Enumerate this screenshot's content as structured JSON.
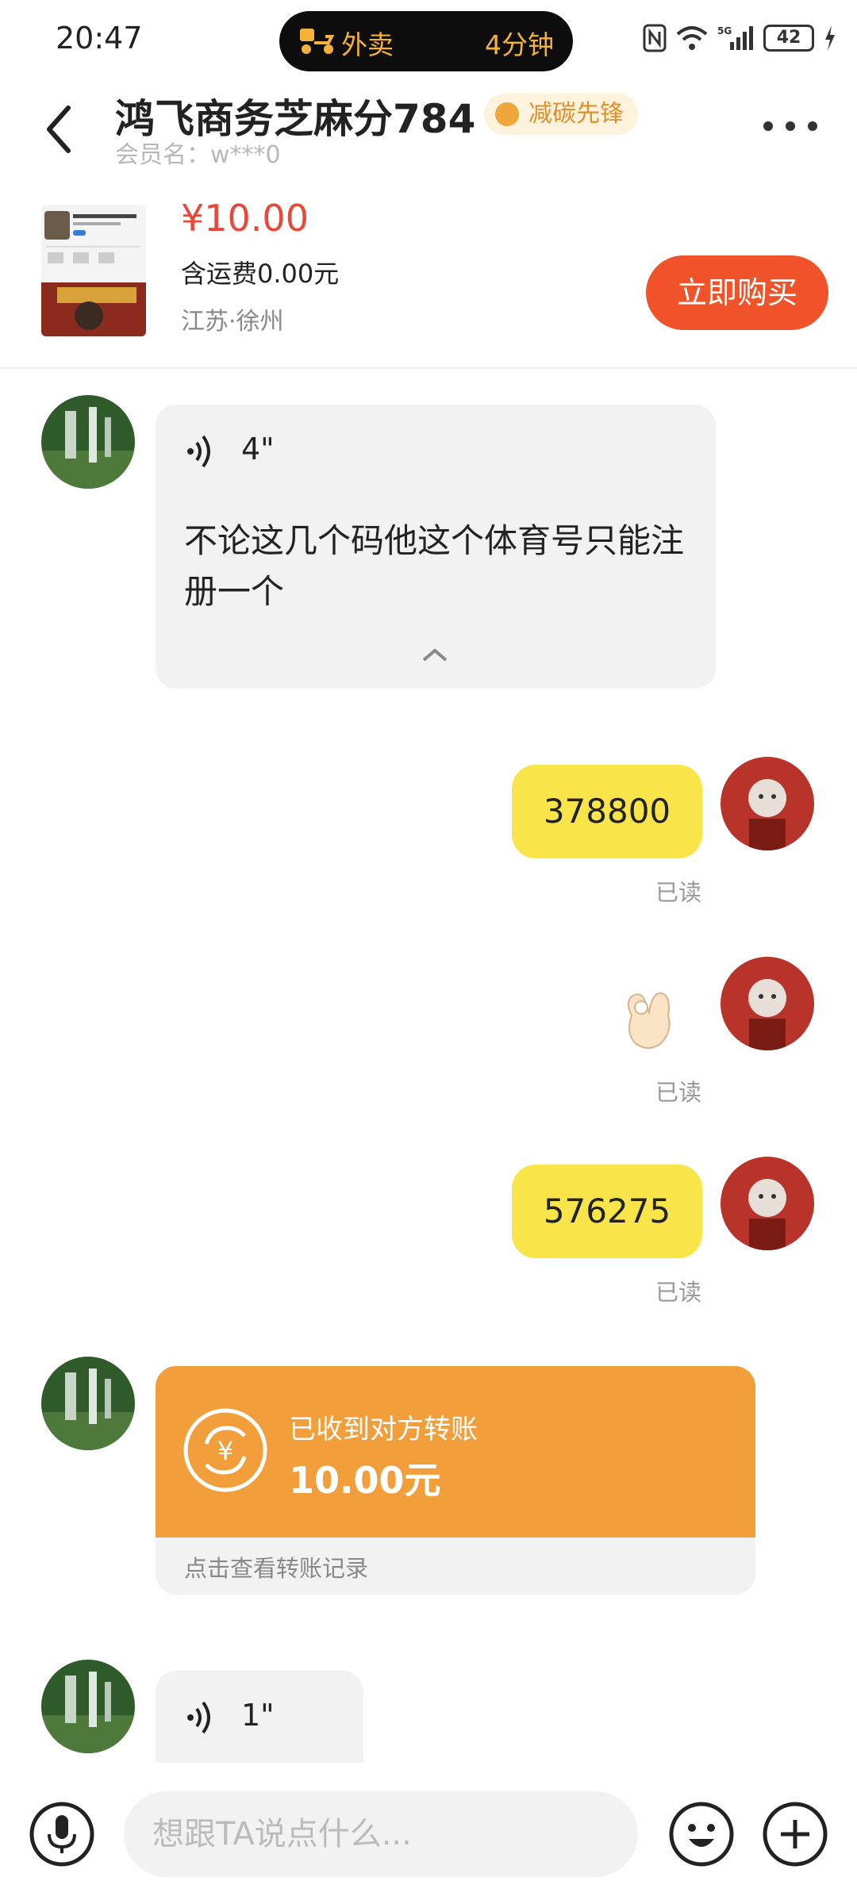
{
  "status_bar": {
    "time": "20:47",
    "activity_label": "外卖",
    "activity_eta": "4分钟",
    "battery": "42"
  },
  "header": {
    "shop_name": "鸿飞商务芝麻分784",
    "badge": "减碳先锋",
    "member": "会员名：w***0"
  },
  "product": {
    "price": "¥10.00",
    "shipping": "含运费0.00元",
    "location": "江苏·徐州",
    "buy_label": "立即购买"
  },
  "messages": {
    "voice1_duration": "4\"",
    "voice1_transcript": "不论这几个码他这个体育号只能注册一个",
    "msg1": "378800",
    "read1": "已读",
    "read2": "已读",
    "msg3": "576275",
    "read3": "已读",
    "transfer_title": "已收到对方转账",
    "transfer_amount": "10.00元",
    "transfer_link": "点击查看转账记录",
    "voice2_duration": "1\""
  },
  "input": {
    "placeholder": "想跟TA说点什么..."
  },
  "colors": {
    "accent_orange": "#f0522a",
    "price_red": "#e8483a",
    "bubble_yellow": "#f9e54a",
    "transfer_orange": "#f29e3a"
  },
  "icons": [
    "back-arrow-icon",
    "more-icon",
    "scooter-icon",
    "nfc-icon",
    "wifi-icon",
    "signal-icon",
    "battery-icon",
    "charging-icon",
    "voice-wave-icon",
    "collapse-chevron-icon",
    "ok-hand-emoji",
    "yuan-coin-icon",
    "mic-icon",
    "emoji-icon",
    "plus-icon"
  ]
}
